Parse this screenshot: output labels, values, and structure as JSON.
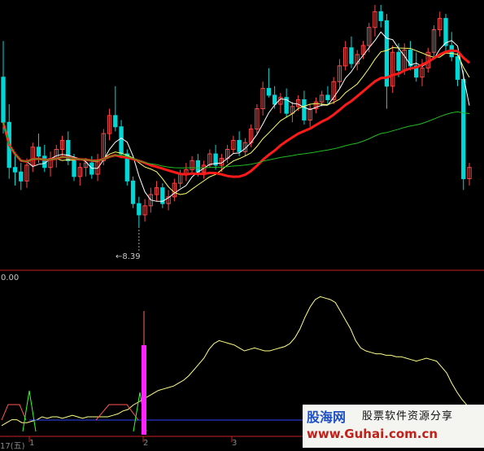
{
  "colors": {
    "background": "#000000",
    "up_candle": "#ff4646",
    "down_candle": "#00d8d8",
    "ma_short": "#ffffff",
    "ma_mid": "#ffff66",
    "ma_thick": "#ff1a1a",
    "ma_long": "#22bb22",
    "divider": "#cc2222",
    "indicator_line": "#ffff88",
    "indicator_green": "#33ff33",
    "indicator_blue": "#3344ff",
    "signal_bar": "#ff22ff",
    "signal_stem": "#ff6666"
  },
  "chart_data": [
    {
      "type": "candlestick",
      "y_range": [
        7.6,
        18.2
      ],
      "min_marker": {
        "label": "←8.39",
        "value": 8.39,
        "index": 23
      },
      "candles": [
        [
          15.0,
          16.6,
          12.5,
          13.0
        ],
        [
          13.0,
          13.8,
          10.5,
          11.0
        ],
        [
          11.0,
          11.6,
          10.2,
          10.8
        ],
        [
          10.8,
          11.2,
          10.0,
          10.4
        ],
        [
          10.4,
          11.4,
          10.1,
          11.1
        ],
        [
          11.1,
          12.1,
          10.8,
          11.9
        ],
        [
          11.9,
          12.5,
          11.2,
          11.5
        ],
        [
          11.5,
          12.0,
          10.8,
          11.0
        ],
        [
          11.0,
          11.7,
          10.6,
          11.4
        ],
        [
          11.4,
          12.0,
          11.0,
          11.8
        ],
        [
          11.8,
          12.4,
          11.4,
          12.2
        ],
        [
          12.2,
          12.6,
          11.1,
          11.3
        ],
        [
          11.3,
          11.6,
          10.4,
          10.6
        ],
        [
          10.6,
          11.2,
          10.2,
          11.0
        ],
        [
          11.0,
          11.4,
          10.6,
          11.2
        ],
        [
          11.2,
          11.5,
          10.5,
          10.7
        ],
        [
          10.7,
          11.6,
          10.4,
          11.3
        ],
        [
          11.3,
          12.7,
          11.1,
          12.5
        ],
        [
          12.5,
          13.6,
          12.2,
          13.3
        ],
        [
          13.3,
          14.6,
          12.6,
          12.8
        ],
        [
          12.8,
          13.1,
          11.4,
          11.6
        ],
        [
          11.6,
          11.8,
          10.2,
          10.4
        ],
        [
          10.4,
          10.6,
          9.2,
          9.4
        ],
        [
          9.4,
          9.7,
          8.39,
          8.9
        ],
        [
          8.9,
          9.6,
          8.6,
          9.3
        ],
        [
          9.3,
          10.1,
          9.0,
          9.8
        ],
        [
          9.8,
          10.4,
          9.5,
          10.1
        ],
        [
          10.1,
          10.3,
          9.2,
          9.4
        ],
        [
          9.4,
          10.0,
          9.1,
          9.7
        ],
        [
          9.7,
          10.5,
          9.5,
          10.3
        ],
        [
          10.3,
          10.9,
          10.1,
          10.7
        ],
        [
          10.7,
          11.2,
          10.4,
          10.9
        ],
        [
          10.9,
          11.5,
          10.7,
          11.3
        ],
        [
          11.3,
          11.6,
          10.6,
          10.8
        ],
        [
          10.8,
          11.3,
          10.5,
          11.1
        ],
        [
          11.1,
          11.8,
          11.0,
          11.6
        ],
        [
          11.6,
          12.0,
          10.9,
          11.1
        ],
        [
          11.1,
          11.6,
          10.8,
          11.4
        ],
        [
          11.4,
          12.0,
          11.2,
          11.8
        ],
        [
          11.8,
          12.4,
          11.6,
          12.2
        ],
        [
          12.2,
          12.6,
          11.5,
          11.7
        ],
        [
          11.7,
          12.3,
          11.5,
          12.1
        ],
        [
          12.1,
          12.9,
          11.9,
          12.7
        ],
        [
          12.7,
          13.8,
          12.5,
          13.6
        ],
        [
          13.6,
          14.8,
          13.3,
          14.5
        ],
        [
          14.5,
          15.4,
          14.1,
          14.2
        ],
        [
          14.2,
          14.6,
          13.6,
          13.8
        ],
        [
          13.8,
          14.3,
          13.4,
          14.1
        ],
        [
          14.1,
          14.5,
          13.2,
          13.4
        ],
        [
          13.4,
          13.9,
          13.0,
          13.7
        ],
        [
          13.7,
          14.2,
          13.5,
          14.0
        ],
        [
          14.0,
          14.4,
          12.9,
          13.1
        ],
        [
          13.1,
          13.8,
          12.8,
          13.6
        ],
        [
          13.6,
          14.1,
          13.4,
          13.9
        ],
        [
          13.9,
          14.4,
          13.7,
          14.2
        ],
        [
          14.2,
          14.6,
          13.8,
          14.0
        ],
        [
          14.0,
          15.0,
          13.8,
          14.8
        ],
        [
          14.8,
          15.8,
          14.5,
          15.5
        ],
        [
          15.5,
          16.6,
          15.3,
          16.3
        ],
        [
          16.3,
          16.8,
          15.4,
          15.6
        ],
        [
          15.6,
          16.2,
          15.3,
          16.0
        ],
        [
          16.0,
          16.6,
          15.8,
          16.4
        ],
        [
          16.4,
          17.4,
          16.1,
          17.2
        ],
        [
          17.2,
          18.2,
          16.8,
          17.9
        ],
        [
          17.9,
          18.2,
          17.2,
          17.5
        ],
        [
          17.5,
          17.8,
          13.6,
          14.6
        ],
        [
          14.6,
          16.4,
          14.3,
          16.1
        ],
        [
          16.1,
          16.5,
          15.0,
          15.3
        ],
        [
          15.3,
          16.5,
          15.1,
          16.2
        ],
        [
          16.2,
          16.6,
          15.3,
          15.5
        ],
        [
          15.5,
          16.1,
          14.8,
          15.0
        ],
        [
          15.0,
          15.8,
          14.6,
          15.4
        ],
        [
          15.4,
          16.3,
          15.2,
          16.1
        ],
        [
          16.1,
          17.3,
          15.9,
          17.1
        ],
        [
          17.1,
          17.9,
          16.8,
          17.6
        ],
        [
          17.6,
          17.8,
          16.1,
          16.4
        ],
        [
          16.4,
          17.0,
          15.7,
          15.9
        ],
        [
          15.9,
          16.1,
          14.6,
          14.9
        ],
        [
          14.9,
          15.3,
          10.0,
          10.5
        ],
        [
          10.5,
          11.2,
          10.2,
          11.0
        ]
      ]
    },
    {
      "type": "line",
      "value_label": "0.00",
      "tick_labels": [
        "17(五)",
        "1",
        "2",
        "3"
      ],
      "y_range": [
        0,
        100
      ],
      "series_values": [
        4,
        6,
        8,
        8,
        6,
        6,
        7,
        8,
        10,
        9,
        10,
        10,
        9,
        10,
        11,
        10,
        9,
        10,
        10,
        10,
        10,
        10,
        11,
        12,
        14,
        15,
        18,
        20,
        22,
        24,
        26,
        28,
        29,
        30,
        31,
        33,
        35,
        38,
        42,
        46,
        50,
        56,
        60,
        62,
        61,
        60,
        59,
        57,
        55,
        56,
        57,
        56,
        55,
        55,
        56,
        57,
        58,
        60,
        64,
        70,
        78,
        85,
        90,
        92,
        91,
        90,
        88,
        82,
        76,
        70,
        62,
        57,
        55,
        54,
        53,
        53,
        52,
        52,
        51,
        51,
        50,
        49,
        48,
        49,
        50,
        49,
        48,
        44,
        40,
        33,
        27,
        22,
        18
      ]
    }
  ],
  "watermark": {
    "brand": "股海网",
    "subtitle": "股票软件资源分享",
    "url": "www.Guhai.com.cn"
  }
}
